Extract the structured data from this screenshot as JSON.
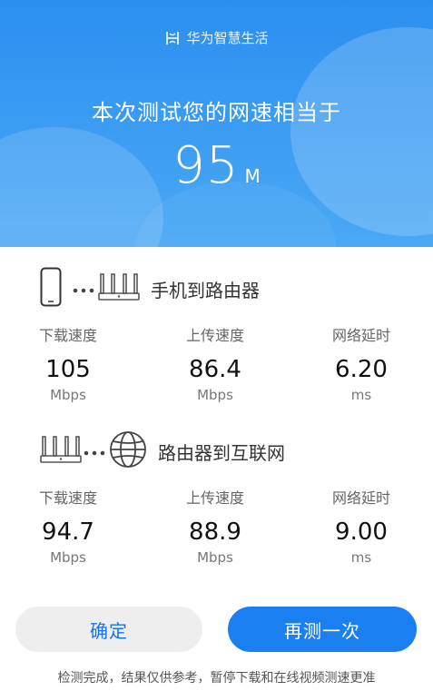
{
  "header": {
    "brand_name": "华为智慧生活",
    "headline": "本次测试您的网速相当于",
    "speed_value": "95",
    "speed_unit": "M",
    "colors": {
      "hero_top": "#2b8ff0",
      "hero_bottom": "#4aa8f5"
    }
  },
  "phone_to_router": {
    "title": "手机到路由器",
    "stats": [
      {
        "label": "下载速度",
        "value": "105",
        "unit": "Mbps"
      },
      {
        "label": "上传速度",
        "value": "86.4",
        "unit": "Mbps"
      },
      {
        "label": "网络延时",
        "value": "6.20",
        "unit": "ms"
      }
    ]
  },
  "router_to_internet": {
    "title": "路由器到互联网",
    "stats": [
      {
        "label": "下载速度",
        "value": "94.7",
        "unit": "Mbps"
      },
      {
        "label": "上传速度",
        "value": "88.9",
        "unit": "Mbps"
      },
      {
        "label": "网络延时",
        "value": "9.00",
        "unit": "ms"
      }
    ]
  },
  "buttons": {
    "confirm": "确定",
    "retest": "再测一次",
    "accent": "#1a7ff0"
  },
  "footnote": "检测完成，结果仅供参考，暂停下载和在线视频测速更准",
  "icons": [
    "huawei-smartlife-logo-icon",
    "phone-icon",
    "ellipsis-icon",
    "router-icon",
    "globe-icon"
  ]
}
